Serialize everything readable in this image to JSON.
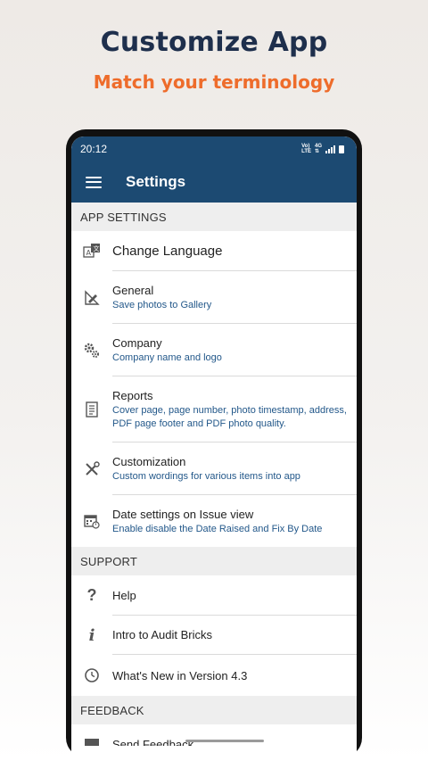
{
  "promo": {
    "title": "Customize App",
    "subtitle": "Match your terminology"
  },
  "status_bar": {
    "time": "20:12",
    "network_top": "Vo)",
    "network_bottom": "LTE",
    "network_type": "4G"
  },
  "app_bar": {
    "title": "Settings"
  },
  "sections": {
    "app_settings": "APP SETTINGS",
    "support": "SUPPORT",
    "feedback": "FEEDBACK"
  },
  "app_settings_items": [
    {
      "title": "Change Language",
      "subtitle": "",
      "icon": "translate-icon"
    },
    {
      "title": "General",
      "subtitle": "Save photos to Gallery",
      "icon": "ruler-pencil-icon"
    },
    {
      "title": "Company",
      "subtitle": "Company name and logo",
      "icon": "gears-icon"
    },
    {
      "title": "Reports",
      "subtitle": "Cover page, page number, photo timestamp, address, PDF page footer and PDF photo quality.",
      "icon": "document-icon"
    },
    {
      "title": "Customization",
      "subtitle": "Custom wordings for various items into app",
      "icon": "tools-icon"
    },
    {
      "title": "Date settings on Issue view",
      "subtitle": "Enable disable the Date Raised and Fix By Date",
      "icon": "calendar-icon"
    }
  ],
  "support_items": [
    {
      "title": "Help",
      "icon": "question-icon"
    },
    {
      "title": "Intro to Audit Bricks",
      "icon": "info-icon"
    },
    {
      "title": "What's New in Version 4.3",
      "icon": "clock-icon"
    }
  ],
  "feedback_items": [
    {
      "title": "Send Feedback",
      "icon": "message-icon"
    }
  ],
  "colors": {
    "app_bar": "#1c4a72",
    "promo_title": "#1e2f4c",
    "promo_subtitle": "#ee6c2b",
    "subtitle_text": "#23588a"
  }
}
